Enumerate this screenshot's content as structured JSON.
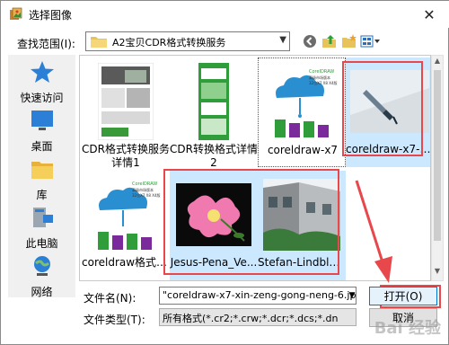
{
  "window": {
    "title": "选择图像",
    "close_glyph": "✕"
  },
  "toolbar": {
    "lookin_label": "查找范围(I):",
    "lookin_value": "A2宝贝CDR格式转换服务",
    "icons": [
      "back-icon",
      "up-folder-icon",
      "new-folder-icon",
      "view-menu-icon"
    ]
  },
  "places": [
    {
      "label": "快速访问",
      "icon": "quick-access-star-icon"
    },
    {
      "label": "桌面",
      "icon": "desktop-icon"
    },
    {
      "label": "库",
      "icon": "library-icon"
    },
    {
      "label": "此电脑",
      "icon": "this-pc-icon"
    },
    {
      "label": "网络",
      "icon": "network-icon"
    }
  ],
  "files": [
    {
      "name": "CDR格式转换服务详情1",
      "selected": false
    },
    {
      "name": "CDR转换格式详情2",
      "selected": false
    },
    {
      "name": "coreldraw-x7",
      "selected": false
    },
    {
      "name": "coreldraw-x7-x...",
      "selected": true
    },
    {
      "name": "coreldraw格式转换",
      "selected": false
    },
    {
      "name": "Jesus-Pena_Ve...",
      "selected": true
    },
    {
      "name": "Stefan-Lindbla...",
      "selected": true
    }
  ],
  "thumb_text": {
    "coreldraw_title": "CorelDRAW",
    "coreldraw_sub": "高级市场版本",
    "coreldraw_ver": "32位X7 X8 X4版"
  },
  "filename": {
    "label": "文件名(N):",
    "value": "\"coreldraw-x7-xin-zeng-gong-neng-6.jp"
  },
  "filetype": {
    "label": "文件类型(T):",
    "value": "所有格式(*.cr2;*.crw;*.dcr;*.dcs;*.dn"
  },
  "buttons": {
    "open": "打开(O)",
    "cancel": "取消"
  },
  "watermark": "Bai 经验",
  "colors": {
    "selection": "#cce8ff",
    "highlight": "#e8474c",
    "accent": "#0078d7"
  }
}
